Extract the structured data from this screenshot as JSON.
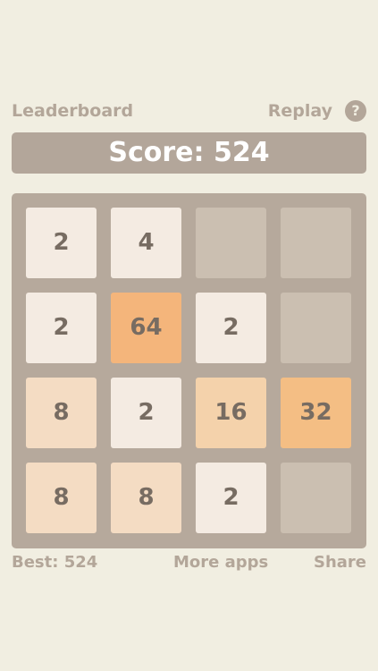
{
  "header": {
    "leaderboard_label": "Leaderboard",
    "replay_label": "Replay",
    "help_label": "?"
  },
  "score": {
    "text": "Score: 524",
    "value": 524
  },
  "board": {
    "rows": [
      [
        "2",
        "4",
        "",
        ""
      ],
      [
        "2",
        "64",
        "2",
        ""
      ],
      [
        "8",
        "2",
        "16",
        "32"
      ],
      [
        "8",
        "8",
        "2",
        ""
      ]
    ]
  },
  "footer": {
    "best_label": "Best: 524",
    "more_apps_label": "More apps",
    "share_label": "Share"
  },
  "colors": {
    "background": "#f1eee1",
    "board": "#b6a99c",
    "empty_cell": "#cbbfb1",
    "tile_2": "#f4ebe2",
    "tile_4": "#f4ebe2",
    "tile_8": "#f4dcc3",
    "tile_16": "#f4d2ab",
    "tile_32": "#f4be84",
    "tile_64": "#f4b57b",
    "link": "#b3a699",
    "tile_text": "#776c62"
  }
}
